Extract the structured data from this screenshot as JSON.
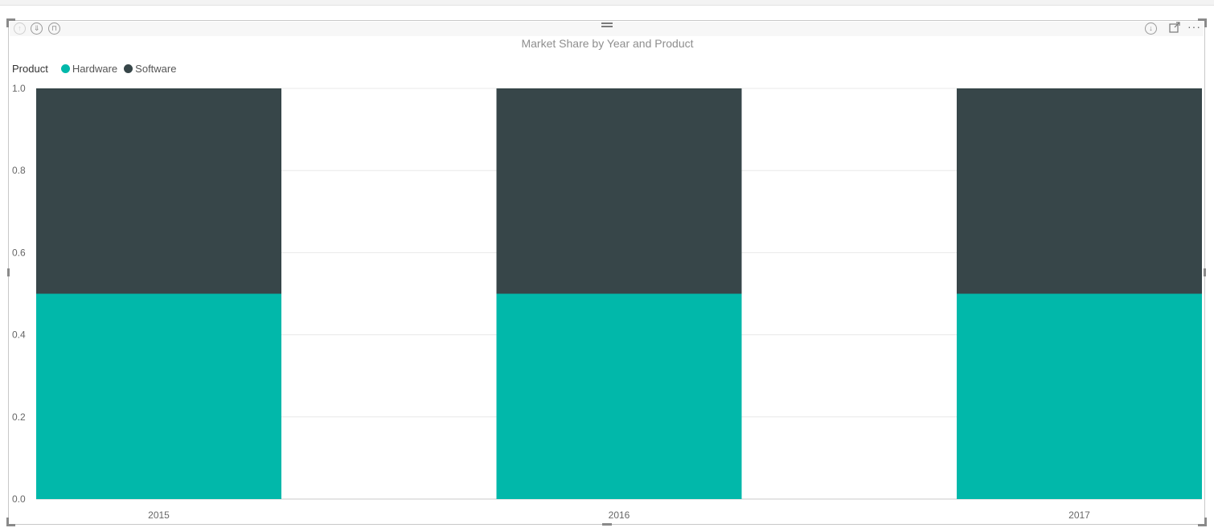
{
  "visual": {
    "title": "Market Share by Year and Product"
  },
  "legend": {
    "title": "Product",
    "items": [
      {
        "label": "Hardware",
        "color": "#01B8AA"
      },
      {
        "label": "Software",
        "color": "#374649"
      }
    ]
  },
  "header_icons": [
    "drill-up-icon",
    "drill-down-all-icon",
    "expand-hierarchy-icon",
    "drill-mode-icon",
    "focus-mode-icon",
    "more-options-icon"
  ],
  "chart_data": {
    "type": "bar",
    "stacked": true,
    "categories": [
      "2015",
      "2016",
      "2017"
    ],
    "series": [
      {
        "name": "Hardware",
        "color": "#01B8AA",
        "values": [
          0.5,
          0.5,
          0.5
        ]
      },
      {
        "name": "Software",
        "color": "#374649",
        "values": [
          0.5,
          0.5,
          0.5
        ]
      }
    ],
    "y_ticks": [
      "0.0",
      "0.2",
      "0.4",
      "0.6",
      "0.8",
      "1.0"
    ],
    "ylim": [
      0,
      1
    ],
    "grid": true,
    "legend_position": "top-left"
  }
}
